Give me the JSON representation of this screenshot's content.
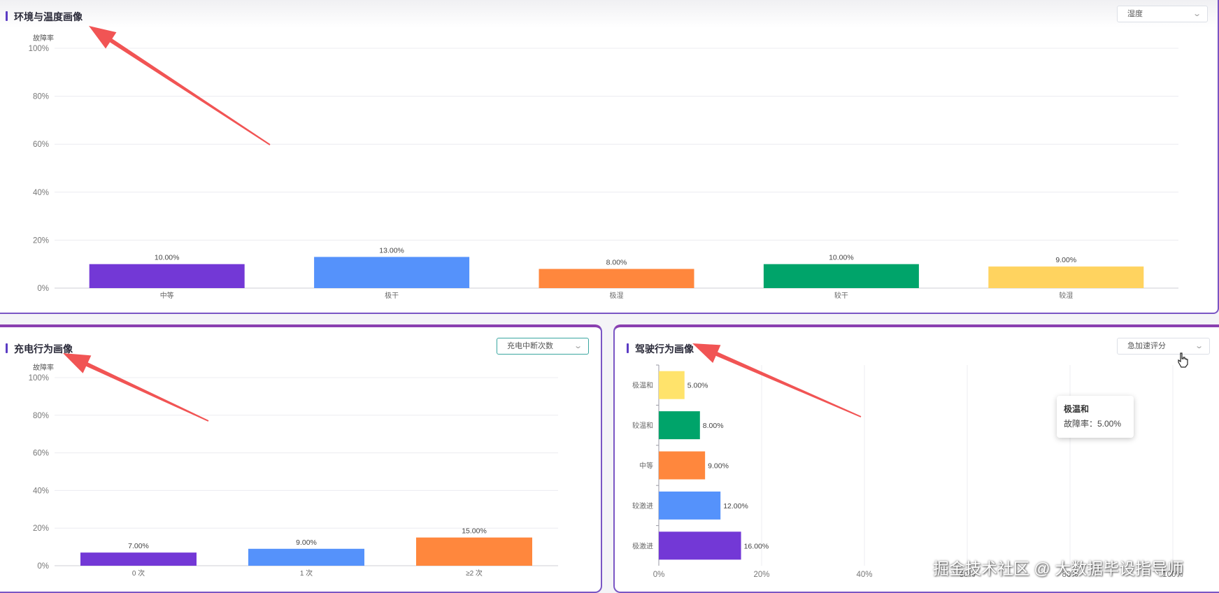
{
  "panels": {
    "env": {
      "title": "环境与温度画像",
      "select": "湿度"
    },
    "charge": {
      "title": "充电行为画像",
      "select": "充电中断次数"
    },
    "drive": {
      "title": "驾驶行为画像",
      "select": "急加速评分"
    }
  },
  "chart_data": [
    {
      "type": "bar",
      "ylabel": "故障率",
      "ylim": [
        0,
        100
      ],
      "yticks": [
        "0%",
        "20%",
        "40%",
        "60%",
        "80%",
        "100%"
      ],
      "categories": [
        "中等",
        "极干",
        "极湿",
        "较干",
        "较湿"
      ],
      "values": [
        10,
        13,
        8,
        10,
        9
      ],
      "labels": [
        "10.00%",
        "13.00%",
        "8.00%",
        "10.00%",
        "9.00%"
      ],
      "colors": [
        "#7338d6",
        "#5592fb",
        "#ff873d",
        "#00a46a",
        "#ffd35f"
      ]
    },
    {
      "type": "bar",
      "ylabel": "故障率",
      "ylim": [
        0,
        100
      ],
      "yticks": [
        "0%",
        "20%",
        "40%",
        "60%",
        "80%",
        "100%"
      ],
      "categories": [
        "0 次",
        "1 次",
        "≥2 次"
      ],
      "values": [
        7,
        9,
        15
      ],
      "labels": [
        "7.00%",
        "9.00%",
        "15.00%"
      ],
      "colors": [
        "#7338d6",
        "#5592fb",
        "#ff873d"
      ]
    },
    {
      "type": "bar",
      "orientation": "horizontal",
      "xlim": [
        0,
        100
      ],
      "xticks": [
        "0%",
        "20%",
        "40%",
        "60%",
        "80%",
        "100%"
      ],
      "categories": [
        "极温和",
        "较温和",
        "中等",
        "较激进",
        "极激进"
      ],
      "values": [
        5,
        8,
        9,
        12,
        16
      ],
      "labels": [
        "5.00%",
        "8.00%",
        "9.00%",
        "12.00%",
        "16.00%"
      ],
      "colors": [
        "#ffe36b",
        "#00a46a",
        "#ff873d",
        "#5592fb",
        "#7338d6"
      ]
    }
  ],
  "tooltip": {
    "title": "极温和",
    "line": "故障率：5.00%"
  },
  "watermark": "掘金技术社区 @ 大数据毕设指导师"
}
